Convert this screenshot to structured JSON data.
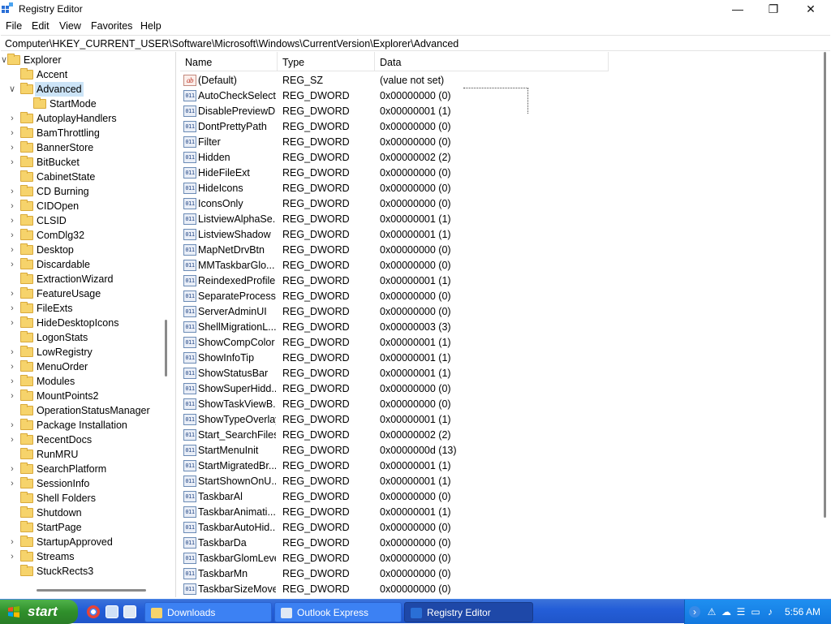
{
  "window": {
    "title": "Registry Editor",
    "min": "—",
    "max": "❐",
    "close": "✕"
  },
  "menu": [
    "File",
    "Edit",
    "View",
    "Favorites",
    "Help"
  ],
  "address": "Computer\\HKEY_CURRENT_USER\\Software\\Microsoft\\Windows\\CurrentVersion\\Explorer\\Advanced",
  "tree": {
    "root": "Explorer",
    "items": [
      {
        "label": "Accent",
        "chevron": ""
      },
      {
        "label": "Advanced",
        "chevron": "∨"
      },
      {
        "label": "StartMode",
        "chevron": ""
      },
      {
        "label": "AutoplayHandlers",
        "chevron": "›"
      },
      {
        "label": "BamThrottling",
        "chevron": "›"
      },
      {
        "label": "BannerStore",
        "chevron": "›"
      },
      {
        "label": "BitBucket",
        "chevron": "›"
      },
      {
        "label": "CabinetState",
        "chevron": ""
      },
      {
        "label": "CD Burning",
        "chevron": "›"
      },
      {
        "label": "CIDOpen",
        "chevron": "›"
      },
      {
        "label": "CLSID",
        "chevron": "›"
      },
      {
        "label": "ComDlg32",
        "chevron": "›"
      },
      {
        "label": "Desktop",
        "chevron": "›"
      },
      {
        "label": "Discardable",
        "chevron": "›"
      },
      {
        "label": "ExtractionWizard",
        "chevron": ""
      },
      {
        "label": "FeatureUsage",
        "chevron": "›"
      },
      {
        "label": "FileExts",
        "chevron": "›"
      },
      {
        "label": "HideDesktopIcons",
        "chevron": "›"
      },
      {
        "label": "LogonStats",
        "chevron": ""
      },
      {
        "label": "LowRegistry",
        "chevron": "›"
      },
      {
        "label": "MenuOrder",
        "chevron": "›"
      },
      {
        "label": "Modules",
        "chevron": "›"
      },
      {
        "label": "MountPoints2",
        "chevron": "›"
      },
      {
        "label": "OperationStatusManager",
        "chevron": ""
      },
      {
        "label": "Package Installation",
        "chevron": "›"
      },
      {
        "label": "RecentDocs",
        "chevron": "›"
      },
      {
        "label": "RunMRU",
        "chevron": ""
      },
      {
        "label": "SearchPlatform",
        "chevron": "›"
      },
      {
        "label": "SessionInfo",
        "chevron": "›"
      },
      {
        "label": "Shell Folders",
        "chevron": ""
      },
      {
        "label": "Shutdown",
        "chevron": ""
      },
      {
        "label": "StartPage",
        "chevron": ""
      },
      {
        "label": "StartupApproved",
        "chevron": "›"
      },
      {
        "label": "Streams",
        "chevron": "›"
      },
      {
        "label": "StuckRects3",
        "chevron": ""
      }
    ]
  },
  "list": {
    "headers": {
      "name": "Name",
      "type": "Type",
      "data": "Data"
    },
    "rows": [
      {
        "icon": "ab",
        "name": "(Default)",
        "type": "REG_SZ",
        "data": "(value not set)"
      },
      {
        "icon": "011",
        "name": "AutoCheckSelect",
        "type": "REG_DWORD",
        "data": "0x00000000 (0)"
      },
      {
        "icon": "011",
        "name": "DisablePreviewD...",
        "type": "REG_DWORD",
        "data": "0x00000001 (1)"
      },
      {
        "icon": "011",
        "name": "DontPrettyPath",
        "type": "REG_DWORD",
        "data": "0x00000000 (0)"
      },
      {
        "icon": "011",
        "name": "Filter",
        "type": "REG_DWORD",
        "data": "0x00000000 (0)"
      },
      {
        "icon": "011",
        "name": "Hidden",
        "type": "REG_DWORD",
        "data": "0x00000002 (2)"
      },
      {
        "icon": "011",
        "name": "HideFileExt",
        "type": "REG_DWORD",
        "data": "0x00000000 (0)"
      },
      {
        "icon": "011",
        "name": "HideIcons",
        "type": "REG_DWORD",
        "data": "0x00000000 (0)"
      },
      {
        "icon": "011",
        "name": "IconsOnly",
        "type": "REG_DWORD",
        "data": "0x00000000 (0)"
      },
      {
        "icon": "011",
        "name": "ListviewAlphaSe...",
        "type": "REG_DWORD",
        "data": "0x00000001 (1)"
      },
      {
        "icon": "011",
        "name": "ListviewShadow",
        "type": "REG_DWORD",
        "data": "0x00000001 (1)"
      },
      {
        "icon": "011",
        "name": "MapNetDrvBtn",
        "type": "REG_DWORD",
        "data": "0x00000000 (0)"
      },
      {
        "icon": "011",
        "name": "MMTaskbarGlo...",
        "type": "REG_DWORD",
        "data": "0x00000000 (0)"
      },
      {
        "icon": "011",
        "name": "ReindexedProfile",
        "type": "REG_DWORD",
        "data": "0x00000001 (1)"
      },
      {
        "icon": "011",
        "name": "SeparateProcess",
        "type": "REG_DWORD",
        "data": "0x00000000 (0)"
      },
      {
        "icon": "011",
        "name": "ServerAdminUI",
        "type": "REG_DWORD",
        "data": "0x00000000 (0)"
      },
      {
        "icon": "011",
        "name": "ShellMigrationL...",
        "type": "REG_DWORD",
        "data": "0x00000003 (3)"
      },
      {
        "icon": "011",
        "name": "ShowCompColor",
        "type": "REG_DWORD",
        "data": "0x00000001 (1)"
      },
      {
        "icon": "011",
        "name": "ShowInfoTip",
        "type": "REG_DWORD",
        "data": "0x00000001 (1)"
      },
      {
        "icon": "011",
        "name": "ShowStatusBar",
        "type": "REG_DWORD",
        "data": "0x00000001 (1)"
      },
      {
        "icon": "011",
        "name": "ShowSuperHidd...",
        "type": "REG_DWORD",
        "data": "0x00000000 (0)"
      },
      {
        "icon": "011",
        "name": "ShowTaskViewB...",
        "type": "REG_DWORD",
        "data": "0x00000000 (0)"
      },
      {
        "icon": "011",
        "name": "ShowTypeOverlay",
        "type": "REG_DWORD",
        "data": "0x00000001 (1)"
      },
      {
        "icon": "011",
        "name": "Start_SearchFiles",
        "type": "REG_DWORD",
        "data": "0x00000002 (2)"
      },
      {
        "icon": "011",
        "name": "StartMenuInit",
        "type": "REG_DWORD",
        "data": "0x0000000d (13)"
      },
      {
        "icon": "011",
        "name": "StartMigratedBr...",
        "type": "REG_DWORD",
        "data": "0x00000001 (1)"
      },
      {
        "icon": "011",
        "name": "StartShownOnU...",
        "type": "REG_DWORD",
        "data": "0x00000001 (1)"
      },
      {
        "icon": "011",
        "name": "TaskbarAl",
        "type": "REG_DWORD",
        "data": "0x00000000 (0)"
      },
      {
        "icon": "011",
        "name": "TaskbarAnimati...",
        "type": "REG_DWORD",
        "data": "0x00000001 (1)"
      },
      {
        "icon": "011",
        "name": "TaskbarAutoHid...",
        "type": "REG_DWORD",
        "data": "0x00000000 (0)"
      },
      {
        "icon": "011",
        "name": "TaskbarDa",
        "type": "REG_DWORD",
        "data": "0x00000000 (0)"
      },
      {
        "icon": "011",
        "name": "TaskbarGlomLevel",
        "type": "REG_DWORD",
        "data": "0x00000000 (0)"
      },
      {
        "icon": "011",
        "name": "TaskbarMn",
        "type": "REG_DWORD",
        "data": "0x00000000 (0)"
      },
      {
        "icon": "011",
        "name": "TaskbarSizeMove",
        "type": "REG_DWORD",
        "data": "0x00000000 (0)"
      }
    ]
  },
  "taskbar": {
    "start": "start",
    "tasks": [
      {
        "label": "Downloads",
        "active": false
      },
      {
        "label": "Outlook Express",
        "active": false
      },
      {
        "label": "Registry Editor",
        "active": true
      }
    ],
    "clock": "5:56 AM"
  },
  "colors": {
    "selection": "#cce4f7",
    "taskbar": "#245ed8",
    "start": "#2f8f2b",
    "tray": "#1278df"
  }
}
